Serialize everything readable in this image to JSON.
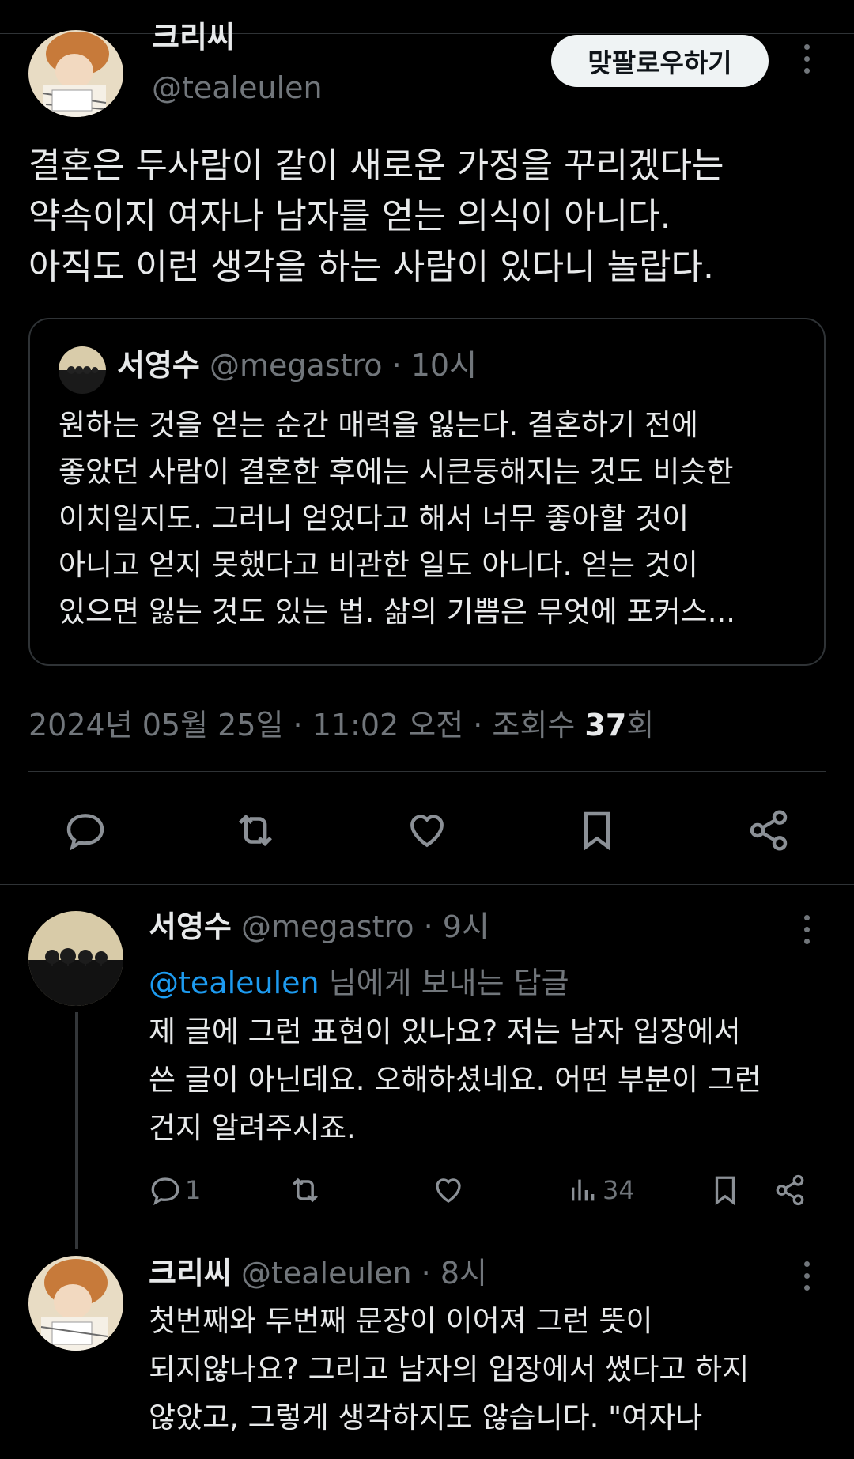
{
  "main_tweet": {
    "author_name": "크리씨",
    "author_handle": "@tealeulen",
    "follow_button": "맞팔로우하기",
    "text_lines": [
      "결혼은 두사람이 같이 새로운 가정을 꾸리겠다는",
      "약속이지 여자나 남자를 얻는 의식이 아니다.",
      "아직도 이런 생각을 하는 사람이 있다니 놀랍다."
    ],
    "quote": {
      "author_name": "서영수",
      "meta": "@megastro · 10시",
      "text_lines": [
        "원하는 것을 얻는 순간 매력을 잃는다. 결혼하기 전에",
        "좋았던 사람이 결혼한 후에는 시큰둥해지는 것도 비슷한",
        "이치일지도. 그러니 얻었다고 해서 너무 좋아할 것이",
        "아니고 얻지 못했다고 비관한 일도 아니다. 얻는 것이",
        "있으면 잃는 것도 있는 법. 삶의 기쁨은 무엇에 포커스..."
      ]
    },
    "timestamp": "2024년 05월 25일 · 11:02 오전 · 조회수 ",
    "views": "37",
    "views_suffix": "회"
  },
  "icons": {
    "reply": "reply-icon",
    "retweet": "retweet-icon",
    "like": "heart-icon",
    "bookmark": "bookmark-icon",
    "share": "share-icon",
    "views": "views-icon",
    "more": "more-icon"
  },
  "replies": [
    {
      "author_name": "서영수",
      "meta": "@megastro · 9시",
      "replying_to_handle": "@tealeulen",
      "replying_to_suffix": " 님에게 보내는 답글",
      "text_lines": [
        "제 글에 그런 표현이 있나요? 저는 남자 입장에서",
        "쓴 글이 아닌데요. 오해하셨네요. 어떤 부분이 그런",
        "건지 알려주시죠."
      ],
      "reply_count": "1",
      "view_count": "34"
    },
    {
      "author_name": "크리씨",
      "meta": "@tealeulen · 8시",
      "text_lines": [
        "첫번째와 두번째 문장이 이어져 그런 뜻이",
        "되지않나요? 그리고 남자의 입장에서 썼다고 하지",
        "않았고, 그렇게 생각하지도 않습니다. \"여자나"
      ]
    }
  ],
  "colors": {
    "background": "#000000",
    "text": "#e7e9ea",
    "secondary": "#71767b",
    "accent": "#1d9bf0",
    "border": "#2f3336"
  }
}
